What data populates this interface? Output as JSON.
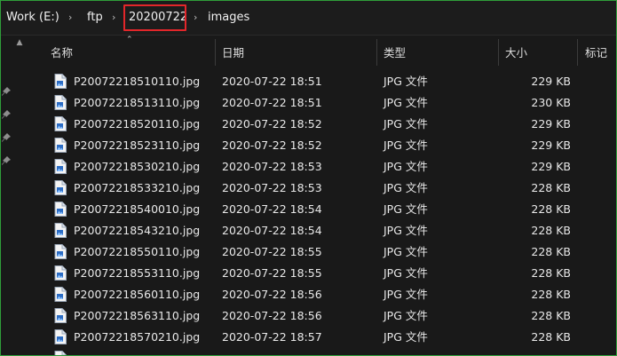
{
  "address": {
    "crumbs": [
      "Work (E:)",
      "ftp",
      "20200722",
      "images"
    ]
  },
  "columns": {
    "name": "名称",
    "date": "日期",
    "type": "类型",
    "size": "大小",
    "tag": "标记"
  },
  "files": [
    {
      "name": "P20072218510110.jpg",
      "date": "2020-07-22 18:51",
      "type": "JPG 文件",
      "size": "229 KB"
    },
    {
      "name": "P20072218513110.jpg",
      "date": "2020-07-22 18:51",
      "type": "JPG 文件",
      "size": "230 KB"
    },
    {
      "name": "P20072218520110.jpg",
      "date": "2020-07-22 18:52",
      "type": "JPG 文件",
      "size": "229 KB"
    },
    {
      "name": "P20072218523110.jpg",
      "date": "2020-07-22 18:52",
      "type": "JPG 文件",
      "size": "229 KB"
    },
    {
      "name": "P20072218530210.jpg",
      "date": "2020-07-22 18:53",
      "type": "JPG 文件",
      "size": "229 KB"
    },
    {
      "name": "P20072218533210.jpg",
      "date": "2020-07-22 18:53",
      "type": "JPG 文件",
      "size": "228 KB"
    },
    {
      "name": "P20072218540010.jpg",
      "date": "2020-07-22 18:54",
      "type": "JPG 文件",
      "size": "228 KB"
    },
    {
      "name": "P20072218543210.jpg",
      "date": "2020-07-22 18:54",
      "type": "JPG 文件",
      "size": "228 KB"
    },
    {
      "name": "P20072218550110.jpg",
      "date": "2020-07-22 18:55",
      "type": "JPG 文件",
      "size": "228 KB"
    },
    {
      "name": "P20072218553110.jpg",
      "date": "2020-07-22 18:55",
      "type": "JPG 文件",
      "size": "228 KB"
    },
    {
      "name": "P20072218560110.jpg",
      "date": "2020-07-22 18:56",
      "type": "JPG 文件",
      "size": "228 KB"
    },
    {
      "name": "P20072218563110.jpg",
      "date": "2020-07-22 18:56",
      "type": "JPG 文件",
      "size": "228 KB"
    },
    {
      "name": "P20072218570210.jpg",
      "date": "2020-07-22 18:57",
      "type": "JPG 文件",
      "size": "228 KB"
    },
    {
      "name": "",
      "date": "",
      "type": "",
      "size": ""
    }
  ],
  "icons": {
    "file": "jpg-file-icon",
    "pin": "pin-icon",
    "separator": "chevron-right-icon"
  },
  "colors": {
    "background": "#191919",
    "highlight": "#e3262a",
    "frame": "#2f9e3a",
    "file_icon_accent": "#2b6cc4"
  }
}
